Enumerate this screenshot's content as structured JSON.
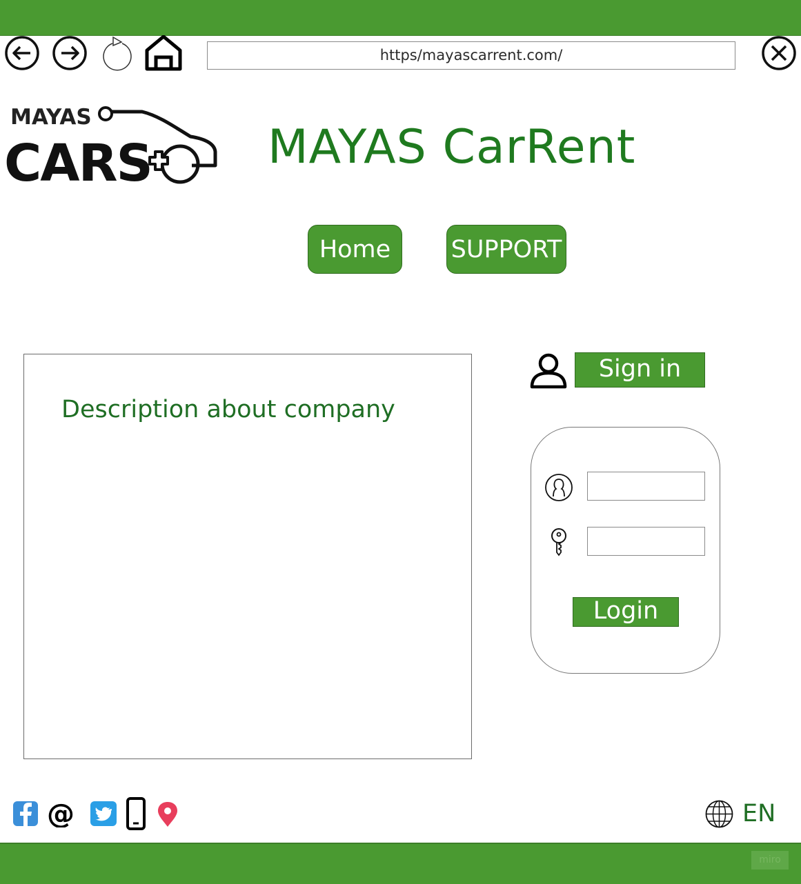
{
  "browser": {
    "url": "https/mayascarrent.com/",
    "icons": {
      "back": "arrow-left-circle-icon",
      "forward": "arrow-right-circle-icon",
      "reload": "reload-icon",
      "home": "home-icon",
      "close": "close-circle-icon"
    }
  },
  "header": {
    "logo_small_text": "MAYAS",
    "logo_big_text": "CARS",
    "site_title": "MAYAS CarRent"
  },
  "nav": {
    "home_label": "Home",
    "support_label": "SUPPORT"
  },
  "main": {
    "description": "Description about company"
  },
  "auth": {
    "signin_label": "Sign in",
    "username_value": "",
    "password_value": "",
    "login_label": "Login"
  },
  "footer": {
    "social_icons": [
      "facebook-icon",
      "email-at-icon",
      "twitter-icon",
      "phone-icon",
      "location-pin-icon"
    ],
    "language": "EN",
    "watermark": "miro"
  },
  "colors": {
    "brand_green": "#4a9a31",
    "title_green": "#1f7a1f",
    "facebook": "#3b8fd9",
    "twitter": "#2a9fe6",
    "pin": "#e83e5c"
  }
}
